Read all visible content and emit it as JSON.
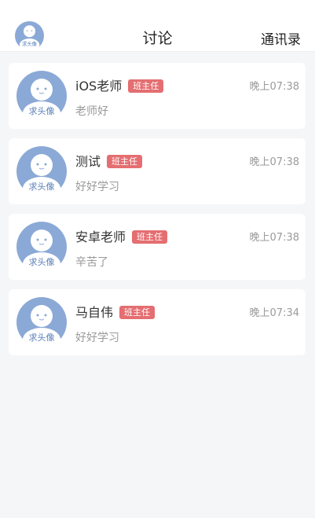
{
  "header": {
    "title": "讨论",
    "right_label": "通讯录",
    "avatar_caption": "求头像"
  },
  "colors": {
    "avatar_bg": "#8ba9d6",
    "badge": "#e46e71",
    "background": "#f5f6f8"
  },
  "conversations": [
    {
      "name": "iOS老师",
      "badge": "班主任",
      "time": "晚上07:38",
      "message": "老师好",
      "avatar_caption": "求头像"
    },
    {
      "name": "测试",
      "badge": "班主任",
      "time": "晚上07:38",
      "message": "好好学习",
      "avatar_caption": "求头像"
    },
    {
      "name": "安卓老师",
      "badge": "班主任",
      "time": "晚上07:38",
      "message": "辛苦了",
      "avatar_caption": "求头像"
    },
    {
      "name": "马自伟",
      "badge": "班主任",
      "time": "晚上07:34",
      "message": "好好学习",
      "avatar_caption": "求头像"
    }
  ]
}
